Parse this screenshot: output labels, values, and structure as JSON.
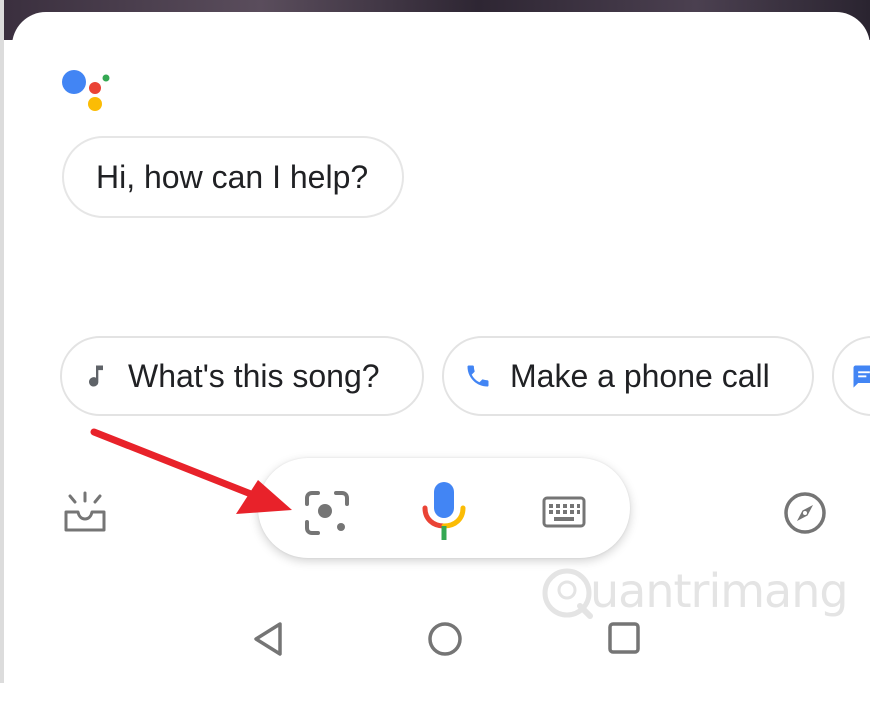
{
  "assistant": {
    "greeting": "Hi, how can I help?"
  },
  "suggestions": [
    {
      "label": "What's this song?",
      "icon": "music-note-icon"
    },
    {
      "label": "Make a phone call",
      "icon": "phone-icon"
    },
    {
      "label": "",
      "icon": "message-icon"
    }
  ],
  "action_bar": {
    "left_icon": "updates-icon",
    "center_icons": [
      "lens-icon",
      "mic-icon",
      "keyboard-icon"
    ],
    "right_icon": "explore-compass-icon"
  },
  "nav_bar": {
    "icons": [
      "back-icon",
      "home-icon",
      "recents-icon"
    ]
  },
  "watermark": {
    "text": "uantrimang"
  },
  "colors": {
    "google_blue": "#4285F4",
    "google_red": "#EA4335",
    "google_yellow": "#FBBC05",
    "google_green": "#34A853",
    "arrow_red": "#E8222A",
    "icon_gray": "#757575"
  }
}
